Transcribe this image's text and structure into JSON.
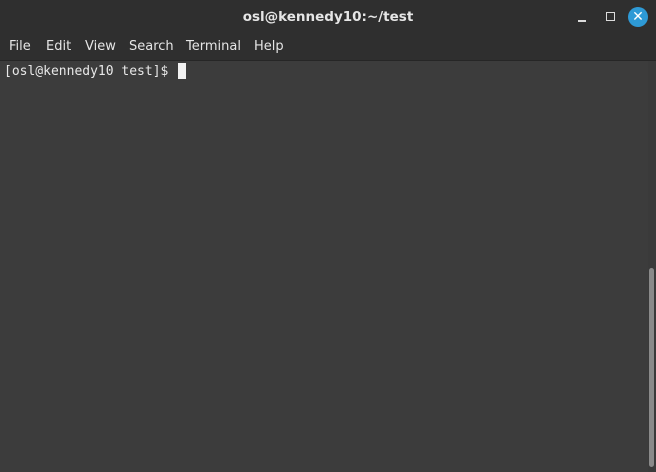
{
  "window": {
    "title": "osl@kennedy10:~/test",
    "controls": {
      "minimize_icon": "minimize-icon",
      "maximize_icon": "maximize-icon",
      "close_icon": "close-icon",
      "close_accent": "#2e9ad6"
    }
  },
  "menubar": {
    "items": [
      "File",
      "Edit",
      "View",
      "Search",
      "Terminal",
      "Help"
    ]
  },
  "terminal": {
    "prompt": "[osl@kennedy10 test]$ "
  }
}
